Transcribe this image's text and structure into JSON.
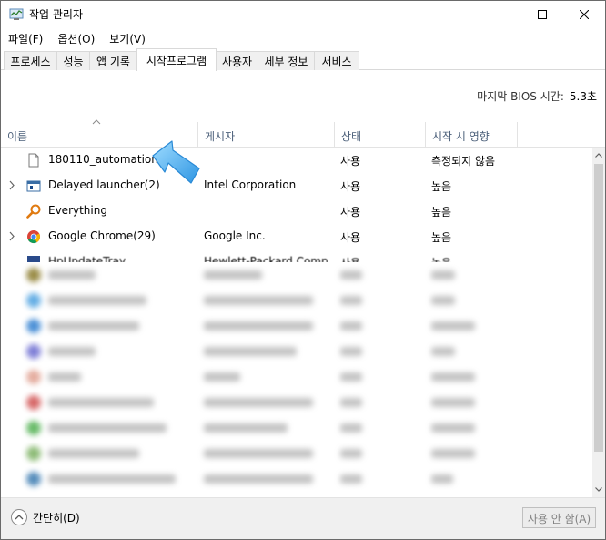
{
  "window": {
    "title": "작업 관리자"
  },
  "menu": [
    "파일(F)",
    "옵션(O)",
    "보기(V)"
  ],
  "tabs": [
    "프로세스",
    "성능",
    "앱 기록",
    "시작프로그램",
    "사용자",
    "세부 정보",
    "서비스"
  ],
  "active_tab": "시작프로그램",
  "bios": {
    "label": "마지막 BIOS 시간:",
    "value": "5.3초"
  },
  "columns": {
    "name": "이름",
    "publisher": "게시자",
    "status": "상태",
    "impact": "시작 시 영향"
  },
  "rows": [
    {
      "name": "180110_automation",
      "publisher": "",
      "status": "사용",
      "impact": "측정되지 않음",
      "icon": "file-icon"
    },
    {
      "name": "Delayed launcher(2)",
      "publisher": "Intel Corporation",
      "status": "사용",
      "impact": "높음",
      "icon": "intel-launcher-icon"
    },
    {
      "name": "Everything",
      "publisher": "",
      "status": "사용",
      "impact": "높음",
      "icon": "everything-search-icon"
    },
    {
      "name": "Google Chrome(29)",
      "publisher": "Google Inc.",
      "status": "사용",
      "impact": "높음",
      "icon": "chrome-icon"
    }
  ],
  "partial_row": {
    "name": "HpUpdateTray",
    "publisher": "Hewlett-Packard Comp",
    "status": "사용",
    "impact": "높음"
  },
  "colors": {
    "header_text": "#4c607a",
    "arrow": "#3fa9e9",
    "footer_bg": "#f0f0f0"
  },
  "footer": {
    "collapse_label": "간단히(D)",
    "disable_label": "사용 안 함(A)"
  }
}
